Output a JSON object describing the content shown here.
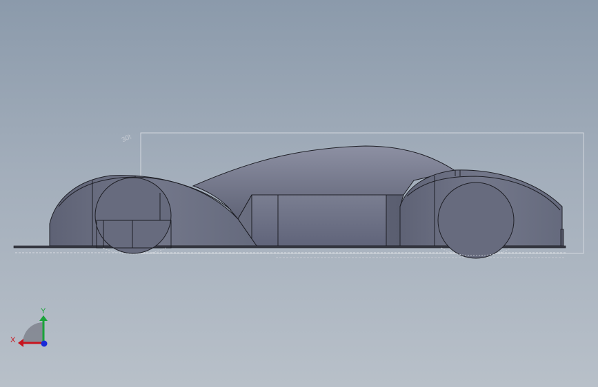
{
  "viewport": {
    "background_top": "#8b9aab",
    "background_bottom": "#b8c0c9"
  },
  "model": {
    "body_color": "#6e7285",
    "edge_color": "#1e1f26",
    "sketch_color": "#c9ced6",
    "dimension_label": "30t"
  },
  "triad": {
    "x_label": "X",
    "y_label": "Y",
    "x_color": "#c8141e",
    "y_color": "#1aa33a",
    "z_color": "#1a2ad8"
  }
}
